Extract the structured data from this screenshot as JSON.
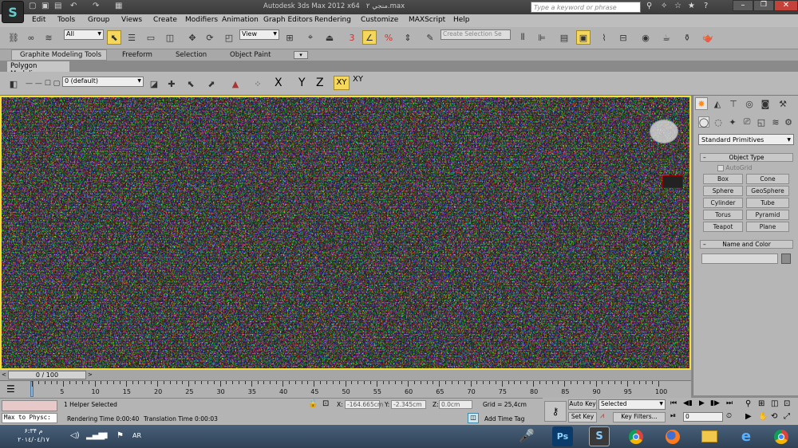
{
  "title": {
    "app": "Autodesk 3ds Max 2012 x64",
    "file": "منجي ٢.max",
    "search_placeholder": "Type a keyword or phrase"
  },
  "menu": [
    "Edit",
    "Tools",
    "Group",
    "Views",
    "Create",
    "Modifiers",
    "Animation",
    "Graph Editors",
    "Rendering",
    "Customize",
    "MAXScript",
    "Help"
  ],
  "maintoolbar": {
    "selection_filter": "All",
    "ref_coord": "View",
    "selection_set_placeholder": "Create Selection Se"
  },
  "ribbon": {
    "tabs": [
      "Graphite Modeling Tools",
      "Freeform",
      "Selection",
      "Object Paint"
    ],
    "panel_tab": "Polygon Modeling",
    "layer": "0 (default)",
    "axis": [
      "X",
      "Y",
      "Z",
      "XY",
      "XY"
    ]
  },
  "command_panel": {
    "category_dropdown": "Standard Primitives",
    "object_type_title": "Object Type",
    "autogrid_label": "AutoGrid",
    "buttons": [
      "Box",
      "Cone",
      "Sphere",
      "GeoSphere",
      "Cylinder",
      "Tube",
      "Torus",
      "Pyramid",
      "Teapot",
      "Plane"
    ],
    "name_color_title": "Name and Color",
    "name_value": "",
    "object_color": "#8c8c8c"
  },
  "timeline": {
    "frame": "0 / 100",
    "ticks": [
      "0",
      "5",
      "10",
      "15",
      "20",
      "25",
      "30",
      "35",
      "40",
      "45",
      "50",
      "55",
      "60",
      "65",
      "70",
      "75",
      "80",
      "85",
      "90",
      "95",
      "100"
    ]
  },
  "status": {
    "maxscript_label": "Max to Physc:",
    "selection_info": "1 Helper Selected",
    "x_label": "X:",
    "x_value": "-164.665cm",
    "y_label": "Y:",
    "y_value": "-2.345cm",
    "z_label": "Z:",
    "z_value": "0.0cm",
    "grid": "Grid = 25,4cm",
    "rendering_time": "Rendering Time  0:00:40",
    "translation_time": "Translation Time  0:00:03",
    "add_time_tag": "Add Time Tag"
  },
  "anim": {
    "auto_key": "Auto Key",
    "set_key": "Set Key",
    "selected": "Selected",
    "key_filters": "Key Filters...",
    "frame_value": "0"
  },
  "taskbar": {
    "time": "۶:٣۴ م",
    "date": "٢٠١٤/٠٤/١٧",
    "lang": "AR",
    "apps": [
      "photoshop-icon",
      "3dsmax-icon",
      "chrome-icon",
      "firefox-icon",
      "explorer-icon",
      "ie-icon",
      "chrome-icon-2"
    ]
  },
  "colors": {
    "viewport_active_border": "#f7e03a",
    "accent_orange": "#ff8a1c"
  }
}
